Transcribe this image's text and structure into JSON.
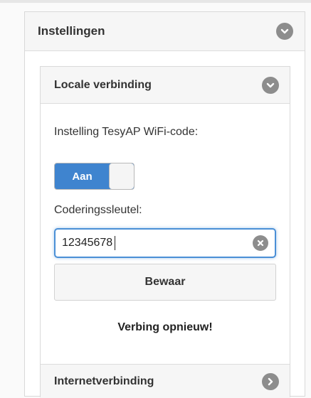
{
  "settings_panel": {
    "title": "Instellingen",
    "toggle_icon": "chevron-down-icon"
  },
  "local_connection": {
    "title": "Locale verbinding",
    "toggle_icon": "chevron-down-icon",
    "wifi_code_label": "Instelling TesyAP WiFi-code:",
    "wifi_code_toggle": {
      "label": "Aan",
      "state": "on"
    },
    "encryption_key_label": "Coderingssleutel:",
    "encryption_key_value": "12345678",
    "clear_icon": "clear-icon",
    "save_button_label": "Bewaar",
    "reconnect_label": "Verbing opnieuw!"
  },
  "internet_connection": {
    "title": "Internetverbinding",
    "toggle_icon": "chevron-right-icon"
  },
  "colors": {
    "accent": "#3f84cf",
    "header_bg": "#f6f6f6",
    "icon_grey": "#8d8d8d"
  }
}
